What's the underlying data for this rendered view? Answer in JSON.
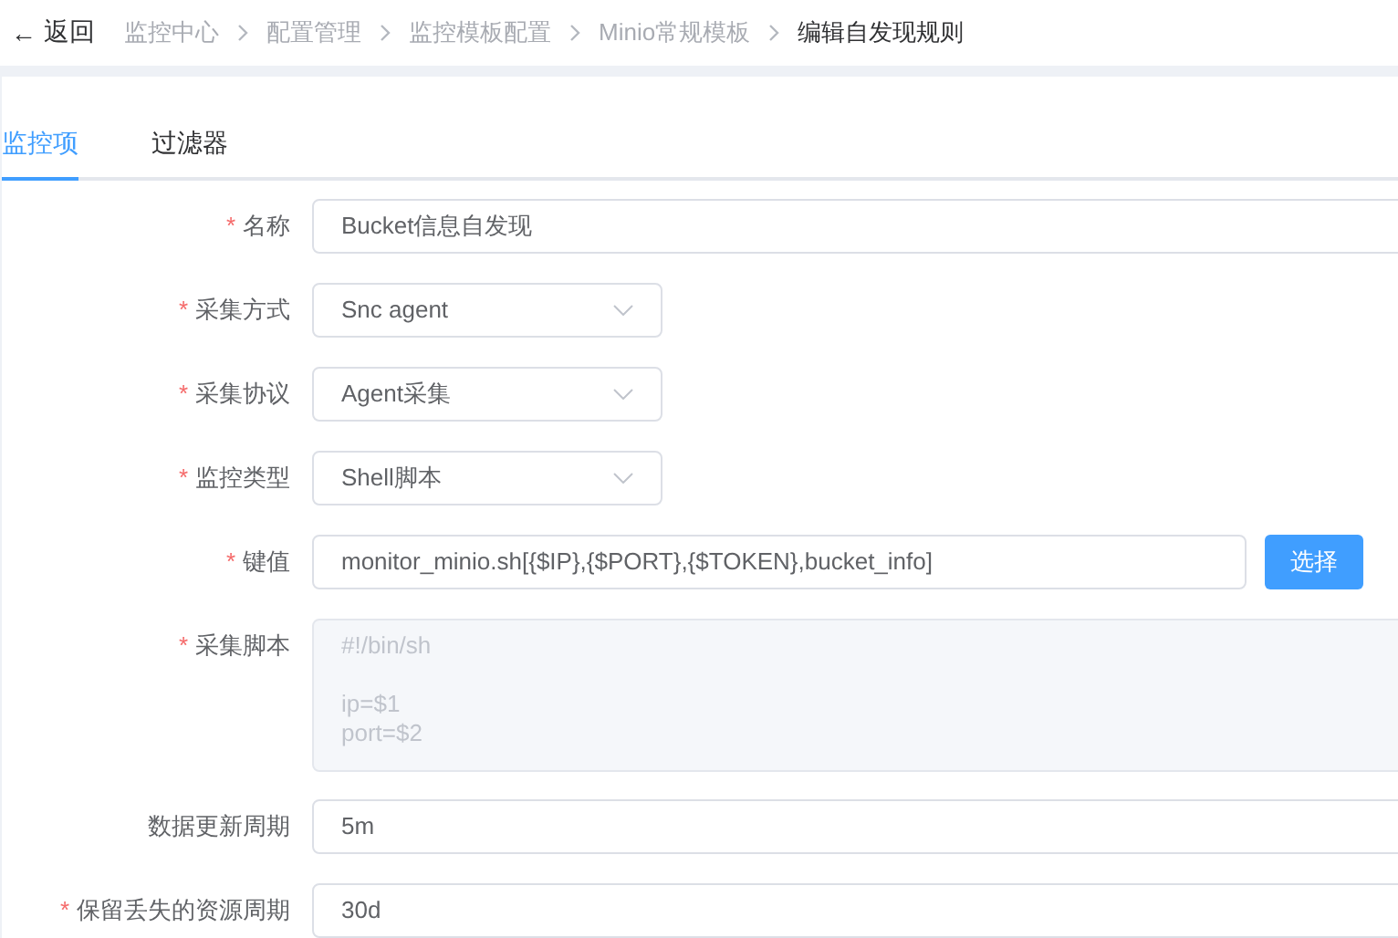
{
  "header": {
    "back": {
      "icon": "←",
      "label": "返回"
    },
    "breadcrumb": [
      {
        "label": "监控中心",
        "current": false
      },
      {
        "label": "配置管理",
        "current": false
      },
      {
        "label": "监控模板配置",
        "current": false
      },
      {
        "label": "Minio常规模板",
        "current": false
      },
      {
        "label": "编辑自发现规则",
        "current": true
      }
    ]
  },
  "tabs": [
    {
      "label": "监控项",
      "selected": true
    },
    {
      "label": "过滤器",
      "selected": false
    }
  ],
  "form": [
    {
      "kind": "text",
      "label": "名称",
      "required_mark": "*",
      "value": "Bucket信息自发现"
    },
    {
      "kind": "select",
      "label": "采集方式",
      "required_mark": "*",
      "value": "Snc agent"
    },
    {
      "kind": "select",
      "label": "采集协议",
      "required_mark": "*",
      "value": "Agent采集"
    },
    {
      "kind": "select",
      "label": "监控类型",
      "required_mark": "*",
      "value": "Shell脚本"
    },
    {
      "kind": "text_button",
      "label": "键值",
      "required_mark": "*",
      "value": "monitor_minio.sh[{$IP},{$PORT},{$TOKEN},bucket_info]",
      "button": "选择"
    },
    {
      "kind": "textarea",
      "label": "采集脚本",
      "required_mark": "*",
      "disabled": true,
      "blocks": [
        [
          "#!/bin/sh"
        ],
        [
          "ip=$1",
          "port=$2"
        ]
      ]
    },
    {
      "kind": "text",
      "label": "数据更新周期",
      "value": "5m"
    },
    {
      "kind": "text",
      "label": "保留丢失的资源周期",
      "required_mark": "*",
      "value": "30d"
    }
  ]
}
